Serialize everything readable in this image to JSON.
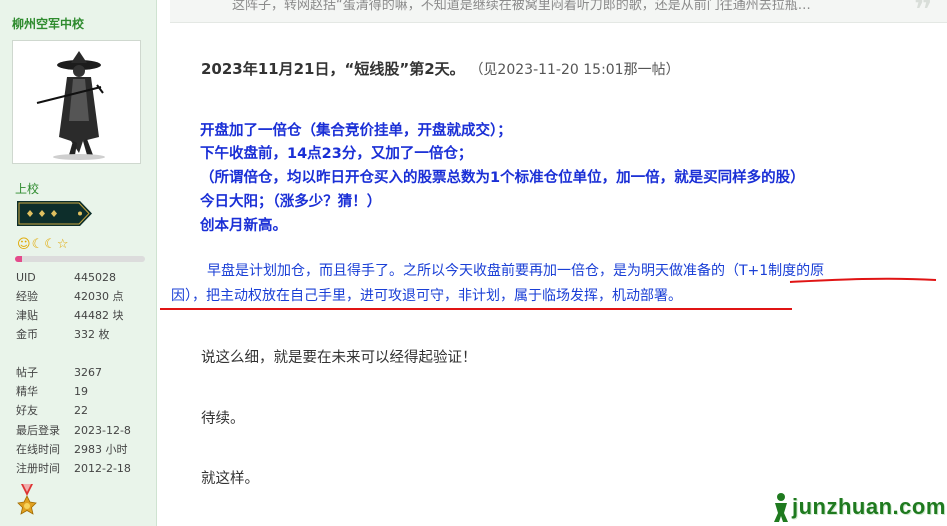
{
  "sidebar": {
    "username": "柳州空军中校",
    "rank_title": "上校",
    "level_icons": [
      "sun-icon",
      "moon-icon",
      "moon-icon",
      "star-icon"
    ],
    "progress_fraction": 0.05,
    "colors": {
      "accent": "#2e8b2e",
      "progress": "#e44b8b",
      "background": "#e9f4ea"
    },
    "stats": [
      {
        "label": "UID",
        "value": "445028"
      },
      {
        "label": "经验",
        "value": "42030 点"
      },
      {
        "label": "津贴",
        "value": "44482 块"
      },
      {
        "label": "金币",
        "value": "332 枚"
      }
    ],
    "stats2": [
      {
        "label": "帖子",
        "value": "3267"
      },
      {
        "label": "精华",
        "value": "19"
      },
      {
        "label": "好友",
        "value": "22"
      },
      {
        "label": "最后登录",
        "value": "2023-12-8"
      },
      {
        "label": "在线时间",
        "value": "2983 小时"
      },
      {
        "label": "注册时间",
        "value": "2012-2-18"
      }
    ]
  },
  "quote": {
    "text": "这阵子，转网赵括“蛋清得的嘛，不知道是继续在被窝里闷着听刀郎的歌，还是从前门往通州去拉瓶…"
  },
  "post": {
    "heading": "2023年11月21日，“短线股”第2天。",
    "reference": "（见2023-11-20 15:01那一帖）",
    "bold_lines": [
      "开盘加了一倍仓（集合竞价挂单，开盘就成交）；",
      "下午收盘前，14点23分，又加了一倍仓；",
      "（所谓倍仓，均以昨日开仓买入的股票总数为1个标准仓位单位，加一倍，就是买同样多的股）",
      "今日大阳；（涨多少？猜！）",
      "创本月新高。"
    ],
    "explain_line1": "早盘是计划加仓，而且得手了。之所以今天收盘前要再加一倍仓，是为明天做准备的（T+1制度的原",
    "explain_line2": "因），把主动权放在自己手里，进可攻退可守，非计划，属于临场发挥，机动部署。",
    "para_detail": "说这么细，就是要在未来可以经得起验证！",
    "para_tbc": "待续。",
    "para_end": "就这样。"
  },
  "watermark": {
    "text": "junzhuan.com",
    "icon": "person-logo-icon"
  }
}
